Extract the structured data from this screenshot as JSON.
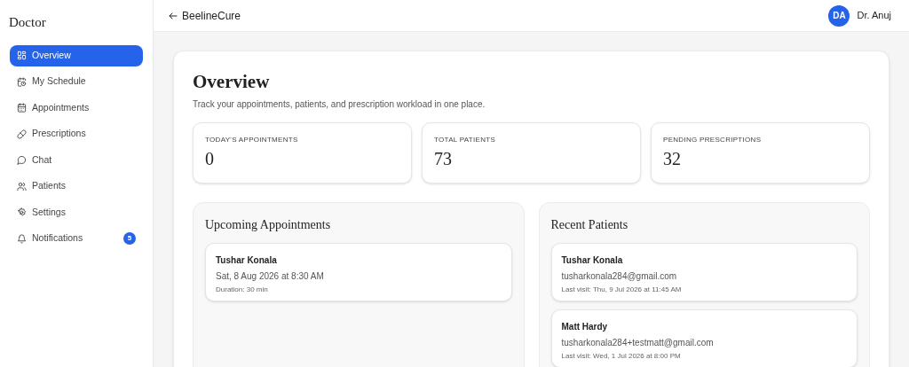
{
  "sidebar": {
    "title": "Doctor",
    "items": [
      {
        "label": "Overview",
        "selected": true
      },
      {
        "label": "My Schedule",
        "selected": false
      },
      {
        "label": "Appointments",
        "selected": false
      },
      {
        "label": "Prescriptions",
        "selected": false
      },
      {
        "label": "Chat",
        "selected": false
      },
      {
        "label": "Patients",
        "selected": false
      },
      {
        "label": "Settings",
        "selected": false
      },
      {
        "label": "Notifications",
        "selected": false,
        "badge": "5"
      }
    ]
  },
  "header": {
    "back_link": "BeelineCure",
    "avatar": "DA",
    "user": "Dr. Anuj"
  },
  "page": {
    "title": "Overview",
    "subtitle": "Track your appointments, patients, and prescription workload in one place.",
    "stats": [
      {
        "label": "TODAY'S APPOINTMENTS",
        "value": "0"
      },
      {
        "label": "TOTAL PATIENTS",
        "value": "73"
      },
      {
        "label": "PENDING PRESCRIPTIONS",
        "value": "32"
      }
    ],
    "upcoming": {
      "title": "Upcoming Appointments",
      "items": [
        {
          "name": "Tushar Konala",
          "when": "Sat, 8 Aug 2026 at 8:30 AM",
          "duration": "Duration: 30 min"
        }
      ]
    },
    "recent": {
      "title": "Recent Patients",
      "items": [
        {
          "name": "Tushar Konala",
          "email": "tusharkonala284@gmail.com",
          "last_visit": "Last visit: Thu, 9 Jul 2026 at 11:45 AM"
        },
        {
          "name": "Matt Hardy",
          "email": "tusharkonala284+testmatt@gmail.com",
          "last_visit": "Last visit: Wed, 1 Jul 2026 at 8:00 PM"
        }
      ]
    }
  }
}
